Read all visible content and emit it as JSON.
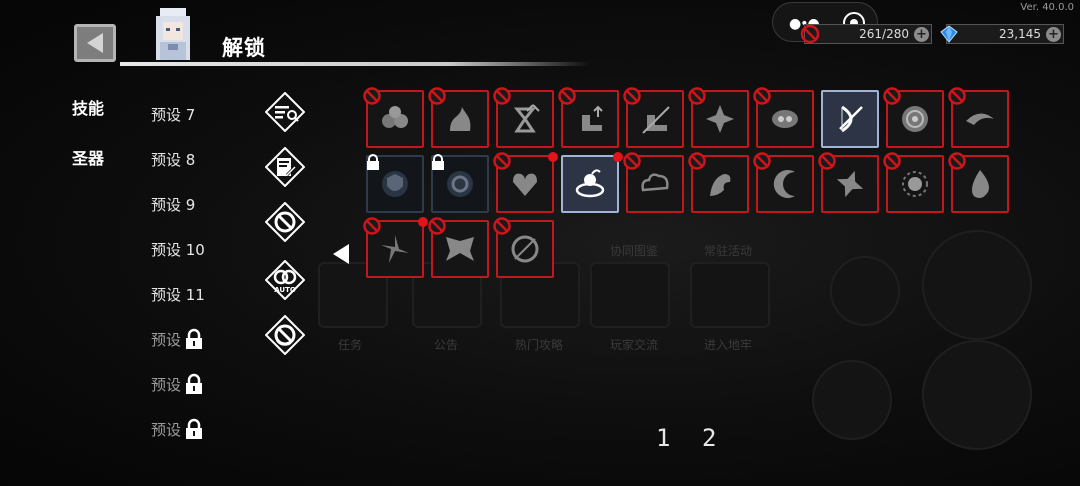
{
  "header": {
    "title": "解锁",
    "version": "Ver. 40.0.0"
  },
  "hud": {
    "energy": "261/280",
    "gems": "23,145",
    "accent_red": "#c0181d",
    "selected_blue": "#9fb4d6"
  },
  "categories": [
    {
      "label": "技能",
      "active": true
    },
    {
      "label": "圣器",
      "active": false
    }
  ],
  "presets": [
    {
      "label": "预设 7",
      "locked": false
    },
    {
      "label": "预设 8",
      "locked": false
    },
    {
      "label": "预设 9",
      "locked": false
    },
    {
      "label": "预设 10",
      "locked": false
    },
    {
      "label": "预设 11",
      "locked": false
    },
    {
      "label": "预设",
      "locked": true
    },
    {
      "label": "预设",
      "locked": true
    },
    {
      "label": "预设",
      "locked": true
    }
  ],
  "tools": [
    {
      "name": "search-filter-icon"
    },
    {
      "name": "scroll-edit-icon"
    },
    {
      "name": "ban-icon"
    },
    {
      "name": "auto-icon",
      "label": "AUTO"
    },
    {
      "name": "ban-cycle-icon"
    }
  ],
  "skills": [
    {
      "icon": "triple-orb-icon",
      "state": "banned"
    },
    {
      "icon": "flame-ghost-icon",
      "state": "banned"
    },
    {
      "icon": "hourglass-up-icon",
      "state": "banned"
    },
    {
      "icon": "boot-up-icon",
      "state": "banned"
    },
    {
      "icon": "boot-slash-icon",
      "state": "banned"
    },
    {
      "icon": "thorn-burst-icon",
      "state": "banned"
    },
    {
      "icon": "eye-cloud-icon",
      "state": "banned"
    },
    {
      "icon": "bow-slash-icon",
      "state": "selected"
    },
    {
      "icon": "spiral-flower-icon",
      "state": "banned"
    },
    {
      "icon": "wing-dash-icon",
      "state": "banned"
    },
    {
      "icon": "shield-ring-icon",
      "state": "locked"
    },
    {
      "icon": "orb-lock-icon",
      "state": "locked"
    },
    {
      "icon": "heart-flame-icon",
      "state": "banned",
      "new": true
    },
    {
      "icon": "vortex-bomb-icon",
      "state": "selected",
      "new": true
    },
    {
      "icon": "cloud-map-icon",
      "state": "banned"
    },
    {
      "icon": "dragon-icon",
      "state": "banned"
    },
    {
      "icon": "crescent-icon",
      "state": "banned"
    },
    {
      "icon": "shuriken-icon",
      "state": "banned"
    },
    {
      "icon": "sun-eye-icon",
      "state": "banned"
    },
    {
      "icon": "droplet-flame-icon",
      "state": "banned"
    },
    {
      "icon": "spin-blades-icon",
      "state": "banned",
      "new": true
    },
    {
      "icon": "demon-wings-icon",
      "state": "banned"
    },
    {
      "icon": "sun-ring-icon",
      "state": "banned"
    }
  ],
  "pagination": {
    "pages": [
      "1",
      "2"
    ]
  },
  "background": {
    "labels": [
      "任务",
      "公告",
      "热门攻略",
      "玩家交流",
      "进入地牢",
      "协同图鉴",
      "常驻活动"
    ]
  }
}
